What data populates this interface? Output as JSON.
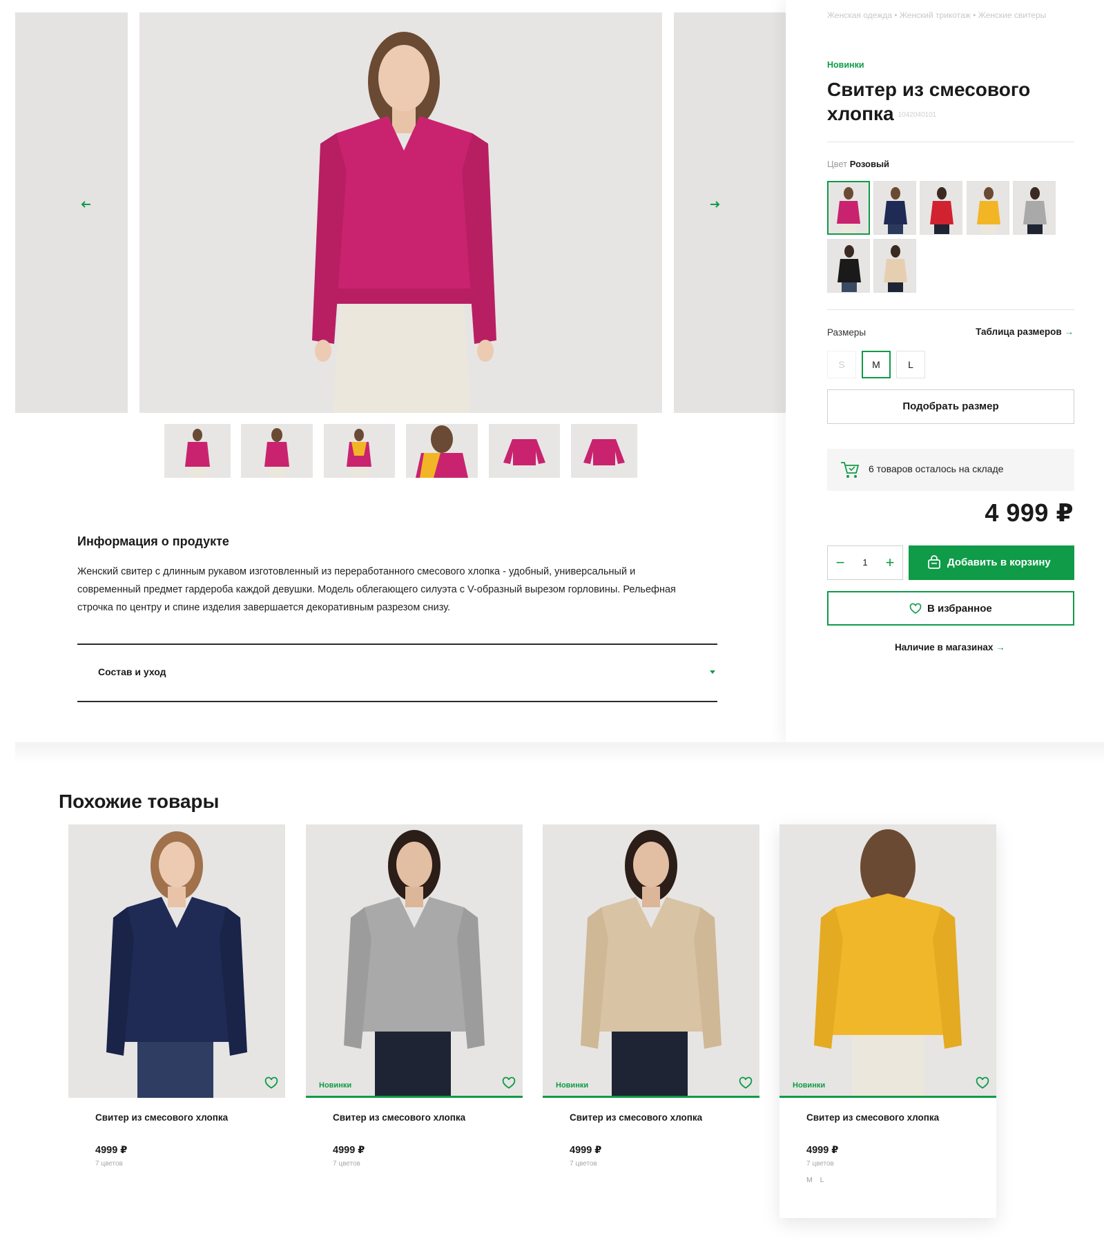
{
  "breadcrumbs": [
    "Женская одежда",
    "Женский трикотаж",
    "Женские свитеры"
  ],
  "product": {
    "badge": "Новинки",
    "title": "Свитер из смесового хлопка",
    "sku": "1042040101",
    "color_label": "Цвет",
    "color_value": "Розовый",
    "sizes_label": "Размеры",
    "size_table_label": "Таблица размеров",
    "sizes": [
      "S",
      "M",
      "L"
    ],
    "selected_size": "M",
    "fit_button": "Подобрать размер",
    "stock_text": "6 товаров осталось на складе",
    "price": "4 999 ₽",
    "quantity": "1",
    "add_to_cart": "Добавить в корзину",
    "favorite": "В избранное",
    "stores": "Наличие в магазинах"
  },
  "info": {
    "title": "Информация о продукте",
    "text": "Женский свитер с длинным рукавом изготовленный из переработанного смесового хлопка - удобный, универсальный и современный предмет гардероба каждой девушки. Модель облегающего силуэта с V-образный вырезом горловины. Рельефная строчка по центру и спине изделия завершается декоративным разрезом снизу.",
    "accordion": "Состав и уход"
  },
  "colors": {
    "accent": "#0f9b47",
    "swatches": [
      "#c9236f",
      "#1f2a55",
      "#d1222f",
      "#f2b526",
      "#a9a9aa",
      "#1a1a1a",
      "#e6cfb1"
    ]
  },
  "similar": {
    "title": "Похожие товары",
    "items": [
      {
        "name": "Свитер из смесового хлопка",
        "price": "4999 ₽",
        "colors": "7 цветов",
        "badge": "",
        "sweater": "#1f2a55"
      },
      {
        "name": "Свитер из смесового хлопка",
        "price": "4999 ₽",
        "colors": "7 цветов",
        "badge": "Новинки",
        "sweater": "#a9a9aa"
      },
      {
        "name": "Свитер из смесового хлопка",
        "price": "4999 ₽",
        "colors": "7 цветов",
        "badge": "Новинки",
        "sweater": "#d9c3a5"
      },
      {
        "name": "Свитер из смесового хлопка",
        "price": "4999 ₽",
        "colors": "7 цветов",
        "badge": "Новинки",
        "sweater": "#f0b72a",
        "sizes": "M L"
      }
    ]
  }
}
